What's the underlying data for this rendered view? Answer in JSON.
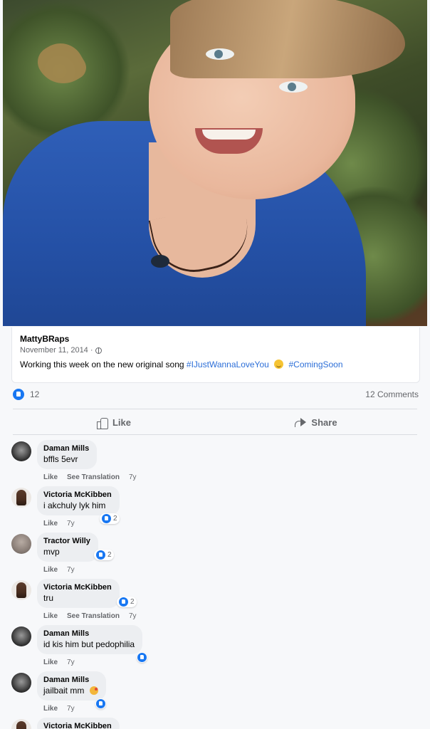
{
  "post": {
    "author": "MattyBRaps",
    "date": "November 11, 2014 ·",
    "text": "Working this week on the new original song",
    "hashtag1": "#IJustWannaLoveYou",
    "hashtag2": "#ComingSoon"
  },
  "reactions": {
    "count": "12",
    "comments": "12 Comments"
  },
  "actions": {
    "like": "Like",
    "share": "Share"
  },
  "comments": [
    {
      "name": "Daman Mills",
      "text": "bffls 5evr",
      "like": "Like",
      "translate": "See Translation",
      "time": "7y",
      "reacts": ""
    },
    {
      "name": "Victoria McKibben",
      "text": "i akchuly lyk him",
      "like": "Like",
      "translate": "",
      "time": "7y",
      "reacts": "2"
    },
    {
      "name": "Tractor Willy",
      "text": "mvp",
      "like": "Like",
      "translate": "",
      "time": "7y",
      "reacts": "2"
    },
    {
      "name": "Victoria McKibben",
      "text": "tru",
      "like": "Like",
      "translate": "See Translation",
      "time": "7y",
      "reacts": "2"
    },
    {
      "name": "Daman Mills",
      "text": "id kis him but pedophilia",
      "like": "Like",
      "translate": "",
      "time": "7y",
      "reacts": ""
    },
    {
      "name": "Daman Mills",
      "text": "jailbait mm",
      "like": "Like",
      "translate": "",
      "time": "7y",
      "reacts": ""
    },
    {
      "name": "Victoria McKibben"
    }
  ],
  "colors": {
    "accent": "#1877f2",
    "hashtag": "#2d6fd8",
    "bubble": "#eceef1"
  },
  "icons": [
    "globe-icon",
    "like-reaction-icon",
    "thumbs-up-icon",
    "share-icon",
    "smiley-emoji-icon"
  ]
}
